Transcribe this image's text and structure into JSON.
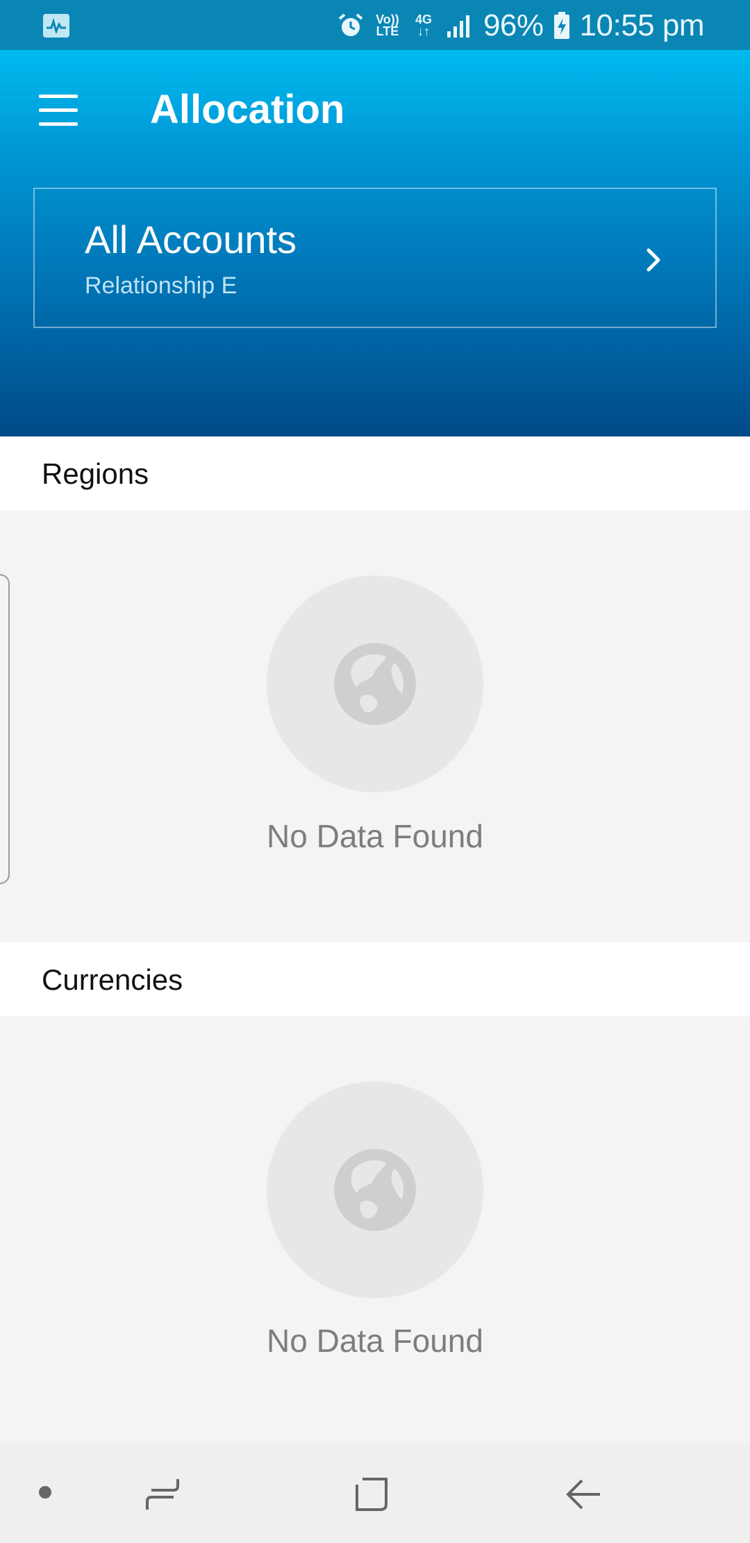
{
  "status_bar": {
    "battery": "96%",
    "time": "10:55 pm",
    "network_volte": "Vo)) LTE",
    "network_type": "4G",
    "icons": [
      "activity-icon",
      "alarm-icon",
      "volte-icon",
      "4g-icon",
      "signal-icon",
      "battery-charging-icon"
    ]
  },
  "header": {
    "title": "Allocation",
    "menu_icon": "menu-icon"
  },
  "account": {
    "title": "All Accounts",
    "subtitle": "Relationship E",
    "chevron_icon": "chevron-right-icon"
  },
  "sections": [
    {
      "title": "Regions",
      "empty_text": "No Data Found",
      "icon": "globe-icon"
    },
    {
      "title": "Currencies",
      "empty_text": "No Data Found",
      "icon": "globe-icon"
    }
  ],
  "nav_bar": {
    "buttons": [
      "dot-indicator",
      "recents-button",
      "home-button",
      "back-button"
    ]
  },
  "colors": {
    "status_bar": "#0a86b4",
    "header_top": "#00bbef",
    "header_bottom": "#004a87",
    "empty_bg": "#f4f4f4",
    "empty_circle": "#e7e7e7",
    "empty_text": "#7d7d7d"
  }
}
